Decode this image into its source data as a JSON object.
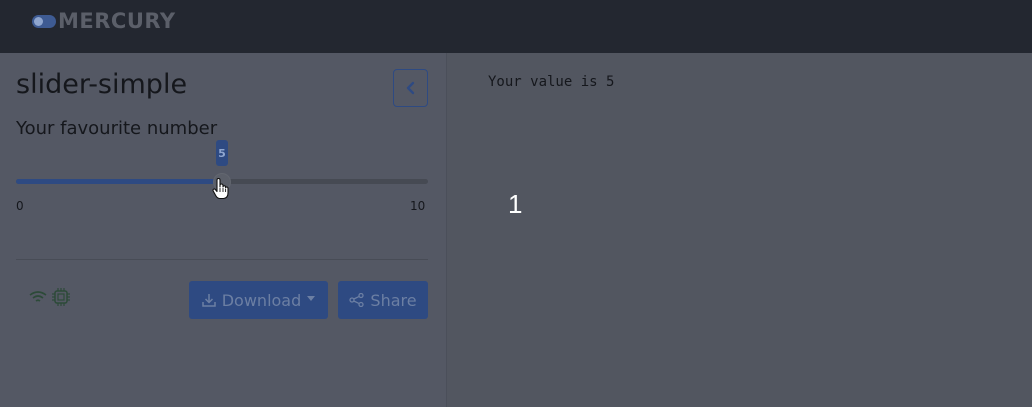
{
  "header": {
    "logo_text": "MERCURY"
  },
  "sidebar": {
    "title": "slider-simple",
    "collapse_icon": "chevron-left-icon",
    "slider": {
      "label": "Your favourite number",
      "value": "5",
      "value_fraction": 0.5,
      "min": "0",
      "max": "10"
    },
    "status_icons": [
      "wifi-icon",
      "cpu-icon"
    ],
    "download_label": "Download",
    "share_label": "Share"
  },
  "main": {
    "output": "Your value is 5",
    "step_number": "1"
  },
  "colors": {
    "topbar": "#232730",
    "background": "#525660",
    "accent": "#2e4a82"
  }
}
